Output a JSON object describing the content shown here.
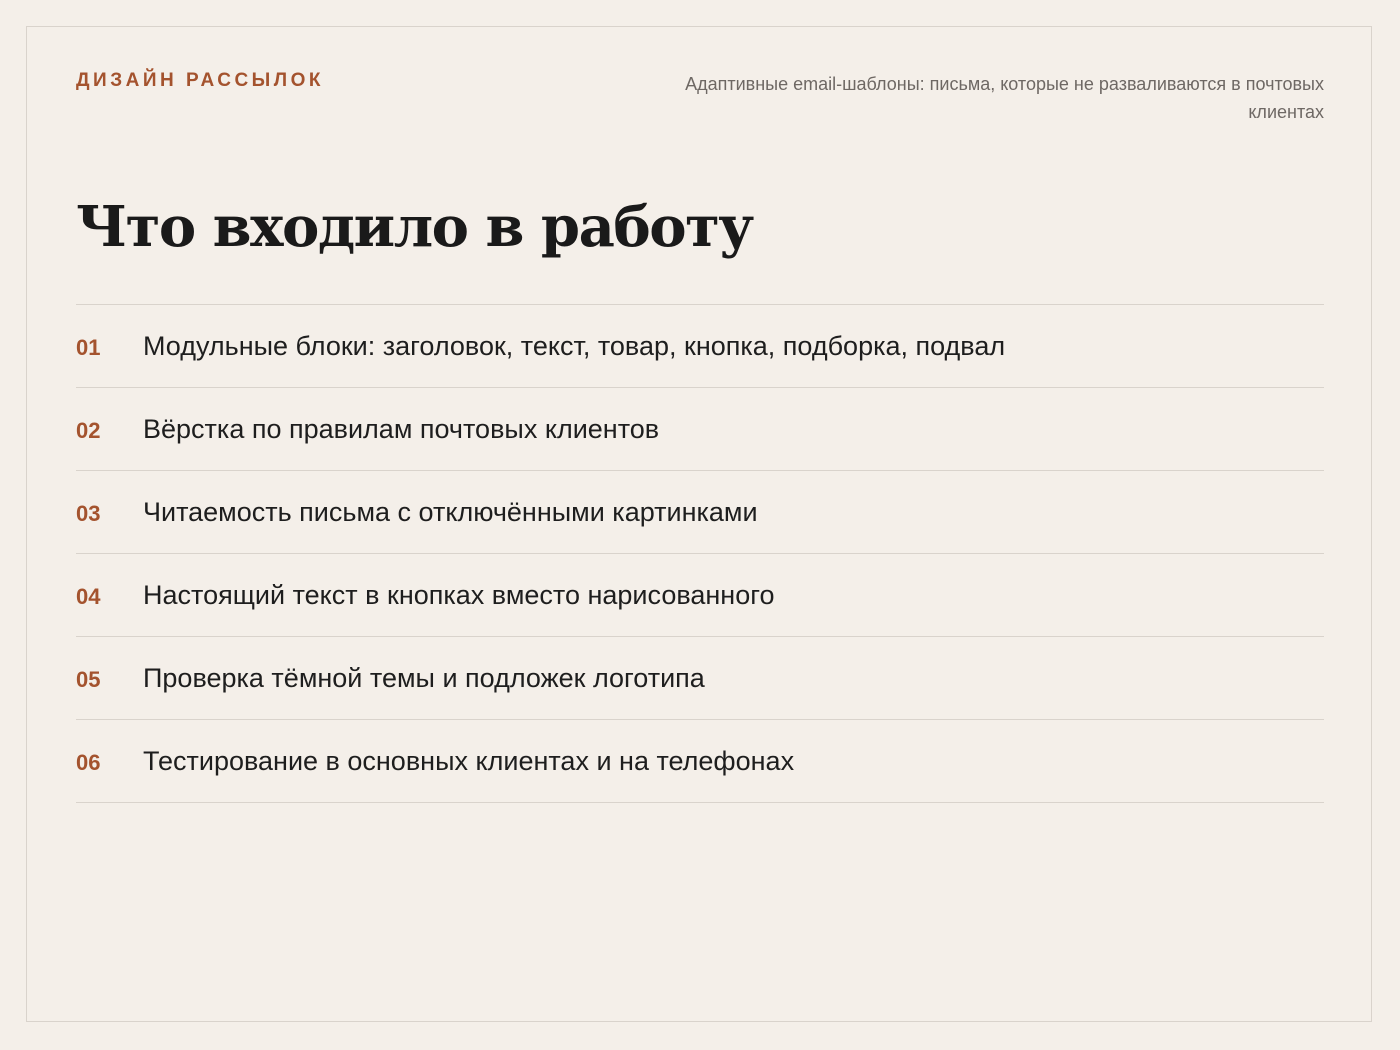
{
  "header": {
    "eyebrow": "ДИЗАЙН РАССЫЛОК",
    "subtitle": "Адаптивные email-шаблоны: письма, которые не разваливаются в почтовых клиентах"
  },
  "main": {
    "title": "Что входило в работу",
    "items": [
      {
        "number": "01",
        "text": "Модульные блоки: заголовок, текст, товар, кнопка, подборка, подвал"
      },
      {
        "number": "02",
        "text": "Вёрстка по правилам почтовых клиентов"
      },
      {
        "number": "03",
        "text": "Читаемость письма с отключёнными картинками"
      },
      {
        "number": "04",
        "text": "Настоящий текст в кнопках вместо нарисованного"
      },
      {
        "number": "05",
        "text": "Проверка тёмной темы и подложек логотипа"
      },
      {
        "number": "06",
        "text": "Тестирование в основных клиентах и на телефонах"
      }
    ]
  },
  "colors": {
    "background": "#f4efe9",
    "accent": "#a4532e",
    "text": "#1e1e1e",
    "muted": "#6e6864",
    "divider": "#d9d3cc"
  }
}
